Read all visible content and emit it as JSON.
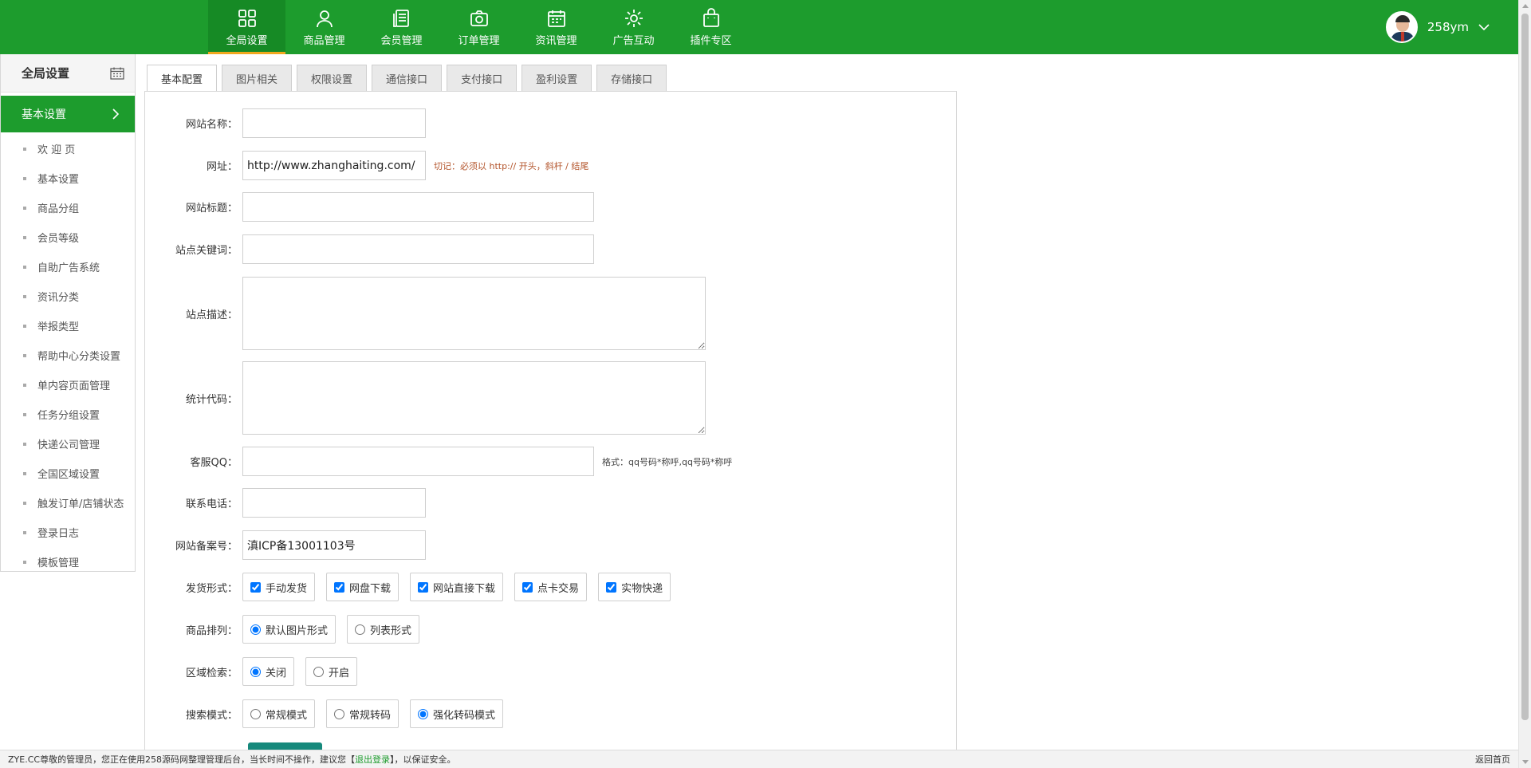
{
  "topnav": {
    "items": [
      {
        "label": "全局设置",
        "icon": "grid-icon",
        "active": true
      },
      {
        "label": "商品管理",
        "icon": "user-icon",
        "active": false
      },
      {
        "label": "会员管理",
        "icon": "document-icon",
        "active": false
      },
      {
        "label": "订单管理",
        "icon": "camera-icon",
        "active": false
      },
      {
        "label": "资讯管理",
        "icon": "calendar-icon",
        "active": false
      },
      {
        "label": "广告互动",
        "icon": "gear-icon",
        "active": false
      },
      {
        "label": "插件专区",
        "icon": "bag-icon",
        "active": false
      }
    ]
  },
  "user": {
    "name": "258ym"
  },
  "sidebar": {
    "title": "全局设置",
    "active_item": "基本设置",
    "items": [
      "欢 迎 页",
      "基本设置",
      "商品分组",
      "会员等级",
      "自助广告系统",
      "资讯分类",
      "举报类型",
      "帮助中心分类设置",
      "单内容页面管理",
      "任务分组设置",
      "快递公司管理",
      "全国区域设置",
      "触发订单/店铺状态",
      "登录日志",
      "模板管理"
    ]
  },
  "tabs": [
    "基本配置",
    "图片相关",
    "权限设置",
    "通信接口",
    "支付接口",
    "盈利设置",
    "存储接口"
  ],
  "form": {
    "site_name_label": "网站名称：",
    "site_name_value": "",
    "url_label": "网址：",
    "url_value": "http://www.zhanghaiting.com/",
    "url_hint": "切记：必须以 http:// 开头，斜杆 / 结尾",
    "site_title_label": "网站标题：",
    "site_title_value": "",
    "keywords_label": "站点关键词：",
    "keywords_value": "",
    "description_label": "站点描述：",
    "stats_code_label": "统计代码：",
    "qq_label": "客服QQ：",
    "qq_value": "",
    "qq_hint": "格式：qq号码*称呼,qq号码*称呼",
    "phone_label": "联系电话：",
    "phone_value": "",
    "icp_label": "网站备案号：",
    "icp_value": "滇ICP备13001103号",
    "delivery_label": "发货形式：",
    "delivery_options": [
      {
        "label": "手动发货",
        "checked": true
      },
      {
        "label": "网盘下载",
        "checked": true
      },
      {
        "label": "网站直接下载",
        "checked": true
      },
      {
        "label": "点卡交易",
        "checked": true
      },
      {
        "label": "实物快递",
        "checked": true
      }
    ],
    "sort_label": "商品排列：",
    "sort_options": [
      {
        "label": "默认图片形式",
        "checked": true
      },
      {
        "label": "列表形式",
        "checked": false
      }
    ],
    "region_label": "区域检索：",
    "region_options": [
      {
        "label": "关闭",
        "checked": true
      },
      {
        "label": "开启",
        "checked": false
      }
    ],
    "search_label": "搜索模式：",
    "search_options": [
      {
        "label": "常规模式",
        "checked": false
      },
      {
        "label": "常规转码",
        "checked": false
      },
      {
        "label": "强化转码模式",
        "checked": true
      }
    ]
  },
  "footer": {
    "text_before": "ZYE.CC尊敬的管理员，您正在使用258源码网整理管理后台，当长时间不操作，建议您【",
    "logout": "退出登录",
    "text_after": "】，以保证安全。",
    "home": "返回首页"
  },
  "colors": {
    "brand_green": "#1d9c2d",
    "active_tab_underline": "#f0a81e",
    "submit": "#16897c"
  }
}
